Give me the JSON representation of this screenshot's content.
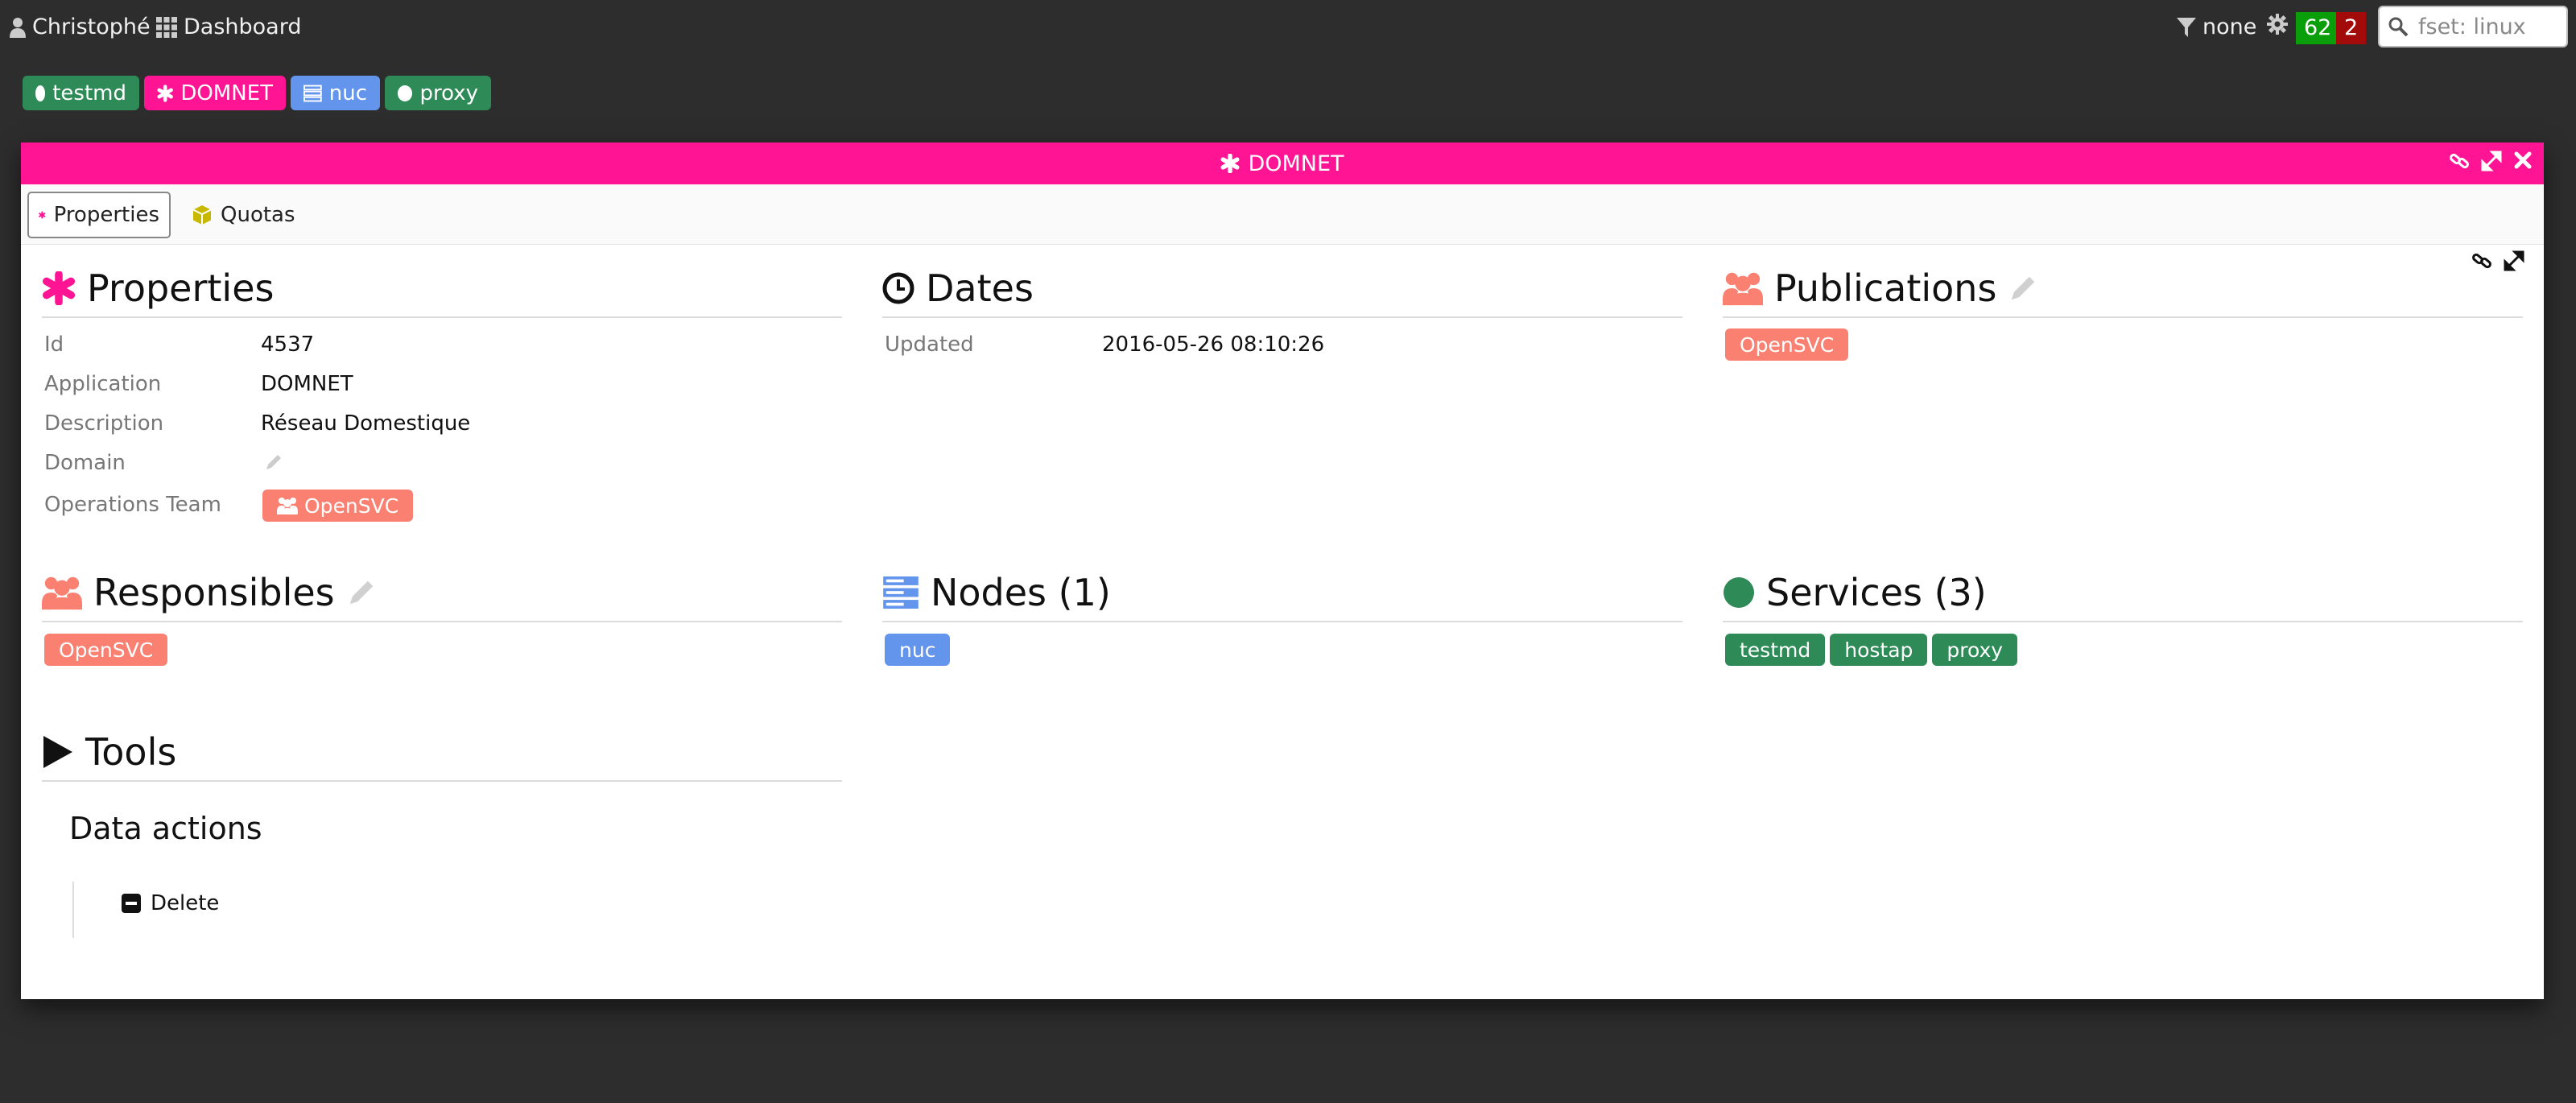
{
  "topbar": {
    "user": "Christophé",
    "dashboard": "Dashboard",
    "filter": "none",
    "count_ok": "62",
    "count_err": "2",
    "search_placeholder": "fset: linux"
  },
  "object_tabs": [
    {
      "label": "testmd",
      "color": "#2e8b57",
      "icon": "circle-icon"
    },
    {
      "label": "DOMNET",
      "color": "#ff1493",
      "icon": "asterisk-icon"
    },
    {
      "label": "nuc",
      "color": "#6495ed",
      "icon": "server-icon"
    },
    {
      "label": "proxy",
      "color": "#2e8b57",
      "icon": "circle-icon"
    }
  ],
  "panel": {
    "title": "DOMNET",
    "color": "#ff1493",
    "tabs": [
      "Properties",
      "Quotas"
    ]
  },
  "properties": {
    "title": "Properties",
    "rows": [
      {
        "key": "Id",
        "value": "4537"
      },
      {
        "key": "Application",
        "value": "DOMNET"
      },
      {
        "key": "Description",
        "value": "Réseau Domestique"
      },
      {
        "key": "Domain",
        "value": ""
      },
      {
        "key": "Operations Team",
        "value": "OpenSVC"
      }
    ]
  },
  "dates": {
    "title": "Dates",
    "rows": [
      {
        "key": "Updated",
        "value": "2016-05-26 08:10:26"
      }
    ]
  },
  "publications": {
    "title": "Publications",
    "items": [
      "OpenSVC"
    ]
  },
  "responsibles": {
    "title": "Responsibles",
    "items": [
      "OpenSVC"
    ]
  },
  "nodes": {
    "title": "Nodes (1)",
    "items": [
      "nuc"
    ]
  },
  "services": {
    "title": "Services (3)",
    "items": [
      "testmd",
      "hostap",
      "proxy"
    ]
  },
  "tools": {
    "title": "Tools",
    "data_actions": "Data actions",
    "delete": "Delete"
  }
}
